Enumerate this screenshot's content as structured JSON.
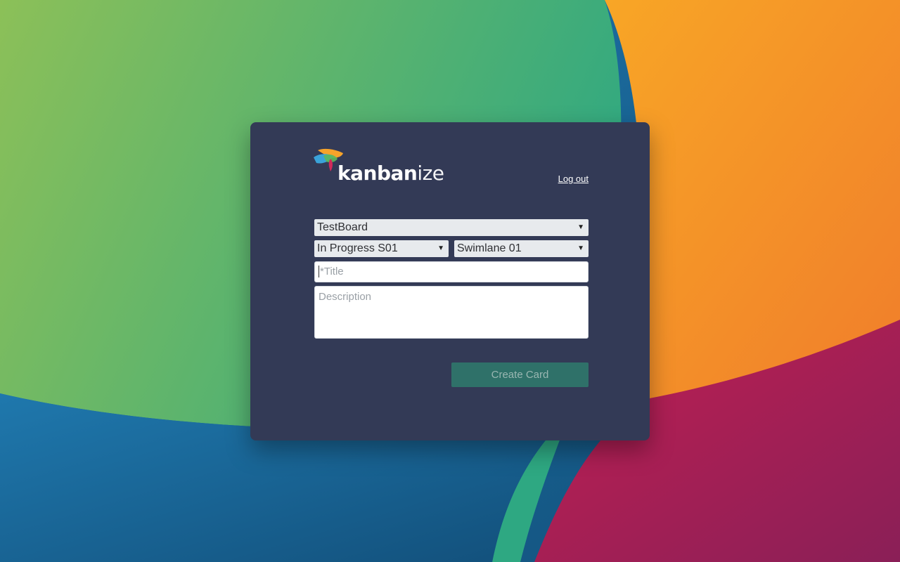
{
  "app": {
    "logo_text_bold": "kanban",
    "logo_text_light": "ize"
  },
  "header": {
    "logout_label": "Log out"
  },
  "form": {
    "board_select": {
      "selected": "TestBoard"
    },
    "column_select": {
      "selected": "In Progress S01"
    },
    "swimlane_select": {
      "selected": "Swimlane 01"
    },
    "title_input": {
      "value": "",
      "placeholder": "*Title"
    },
    "description_input": {
      "value": "",
      "placeholder": "Description"
    },
    "create_button_label": "Create Card"
  },
  "colors": {
    "panel_bg": "#333a56",
    "button_bg": "#2f7169",
    "button_text": "#9ab7b2",
    "bg_green": "#7cbf5f",
    "bg_orange": "#f39324",
    "bg_blue": "#1b6aa0",
    "bg_magenta": "#a21f54"
  }
}
